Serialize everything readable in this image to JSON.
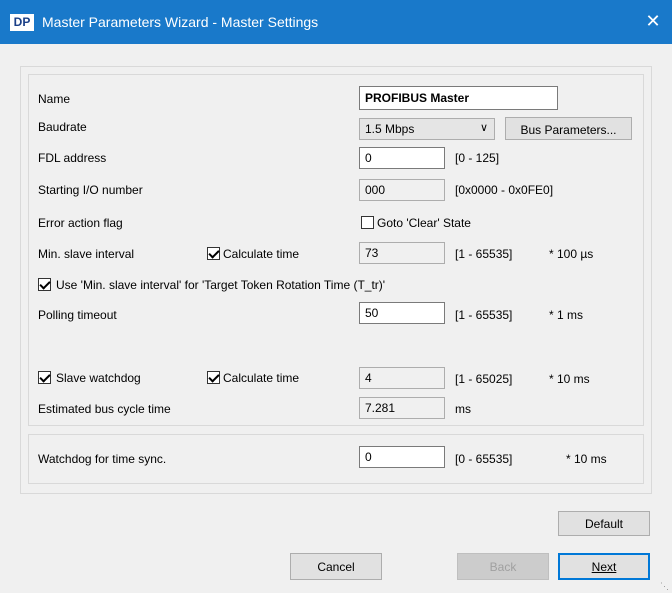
{
  "window": {
    "icon_label": "DP",
    "title": "Master Parameters Wizard - Master Settings",
    "close_label": "✕"
  },
  "fields": {
    "name": {
      "label": "Name",
      "value": "PROFIBUS Master"
    },
    "baudrate": {
      "label": "Baudrate",
      "value": "1.5 Mbps",
      "button": "Bus Parameters..."
    },
    "fdl_address": {
      "label": "FDL address",
      "value": "0",
      "range": "[0 - 125]"
    },
    "starting_io": {
      "label": "Starting I/O number",
      "value": "000",
      "range": "[0x0000 - 0x0FE0]"
    },
    "error_action": {
      "label": "Error action flag",
      "checkbox_label": "Goto 'Clear' State",
      "checked": false
    },
    "min_slave_interval": {
      "label": "Min. slave interval",
      "calc_label": "Calculate time",
      "calc_checked": true,
      "value": "73",
      "range": "[1 - 65535]",
      "unit": "* 100 µs"
    },
    "use_min_slave": {
      "label": "Use 'Min. slave interval' for 'Target Token Rotation Time (T_tr)'",
      "checked": true
    },
    "polling_timeout": {
      "label": "Polling timeout",
      "value": "50",
      "range": "[1 - 65535]",
      "unit": "* 1 ms"
    },
    "slave_watchdog": {
      "label": "Slave watchdog",
      "checked": true,
      "calc_label": "Calculate time",
      "calc_checked": true,
      "value": "4",
      "range": "[1 - 65025]",
      "unit": "* 10 ms"
    },
    "est_bus_cycle": {
      "label": "Estimated bus cycle time",
      "value": "7.281",
      "unit": "ms"
    },
    "watchdog_sync": {
      "label": "Watchdog for time sync.",
      "value": "0",
      "range": "[0 - 65535]",
      "unit": "* 10 ms"
    }
  },
  "buttons": {
    "default": "Default",
    "cancel": "Cancel",
    "back": "Back",
    "next": "Next"
  }
}
